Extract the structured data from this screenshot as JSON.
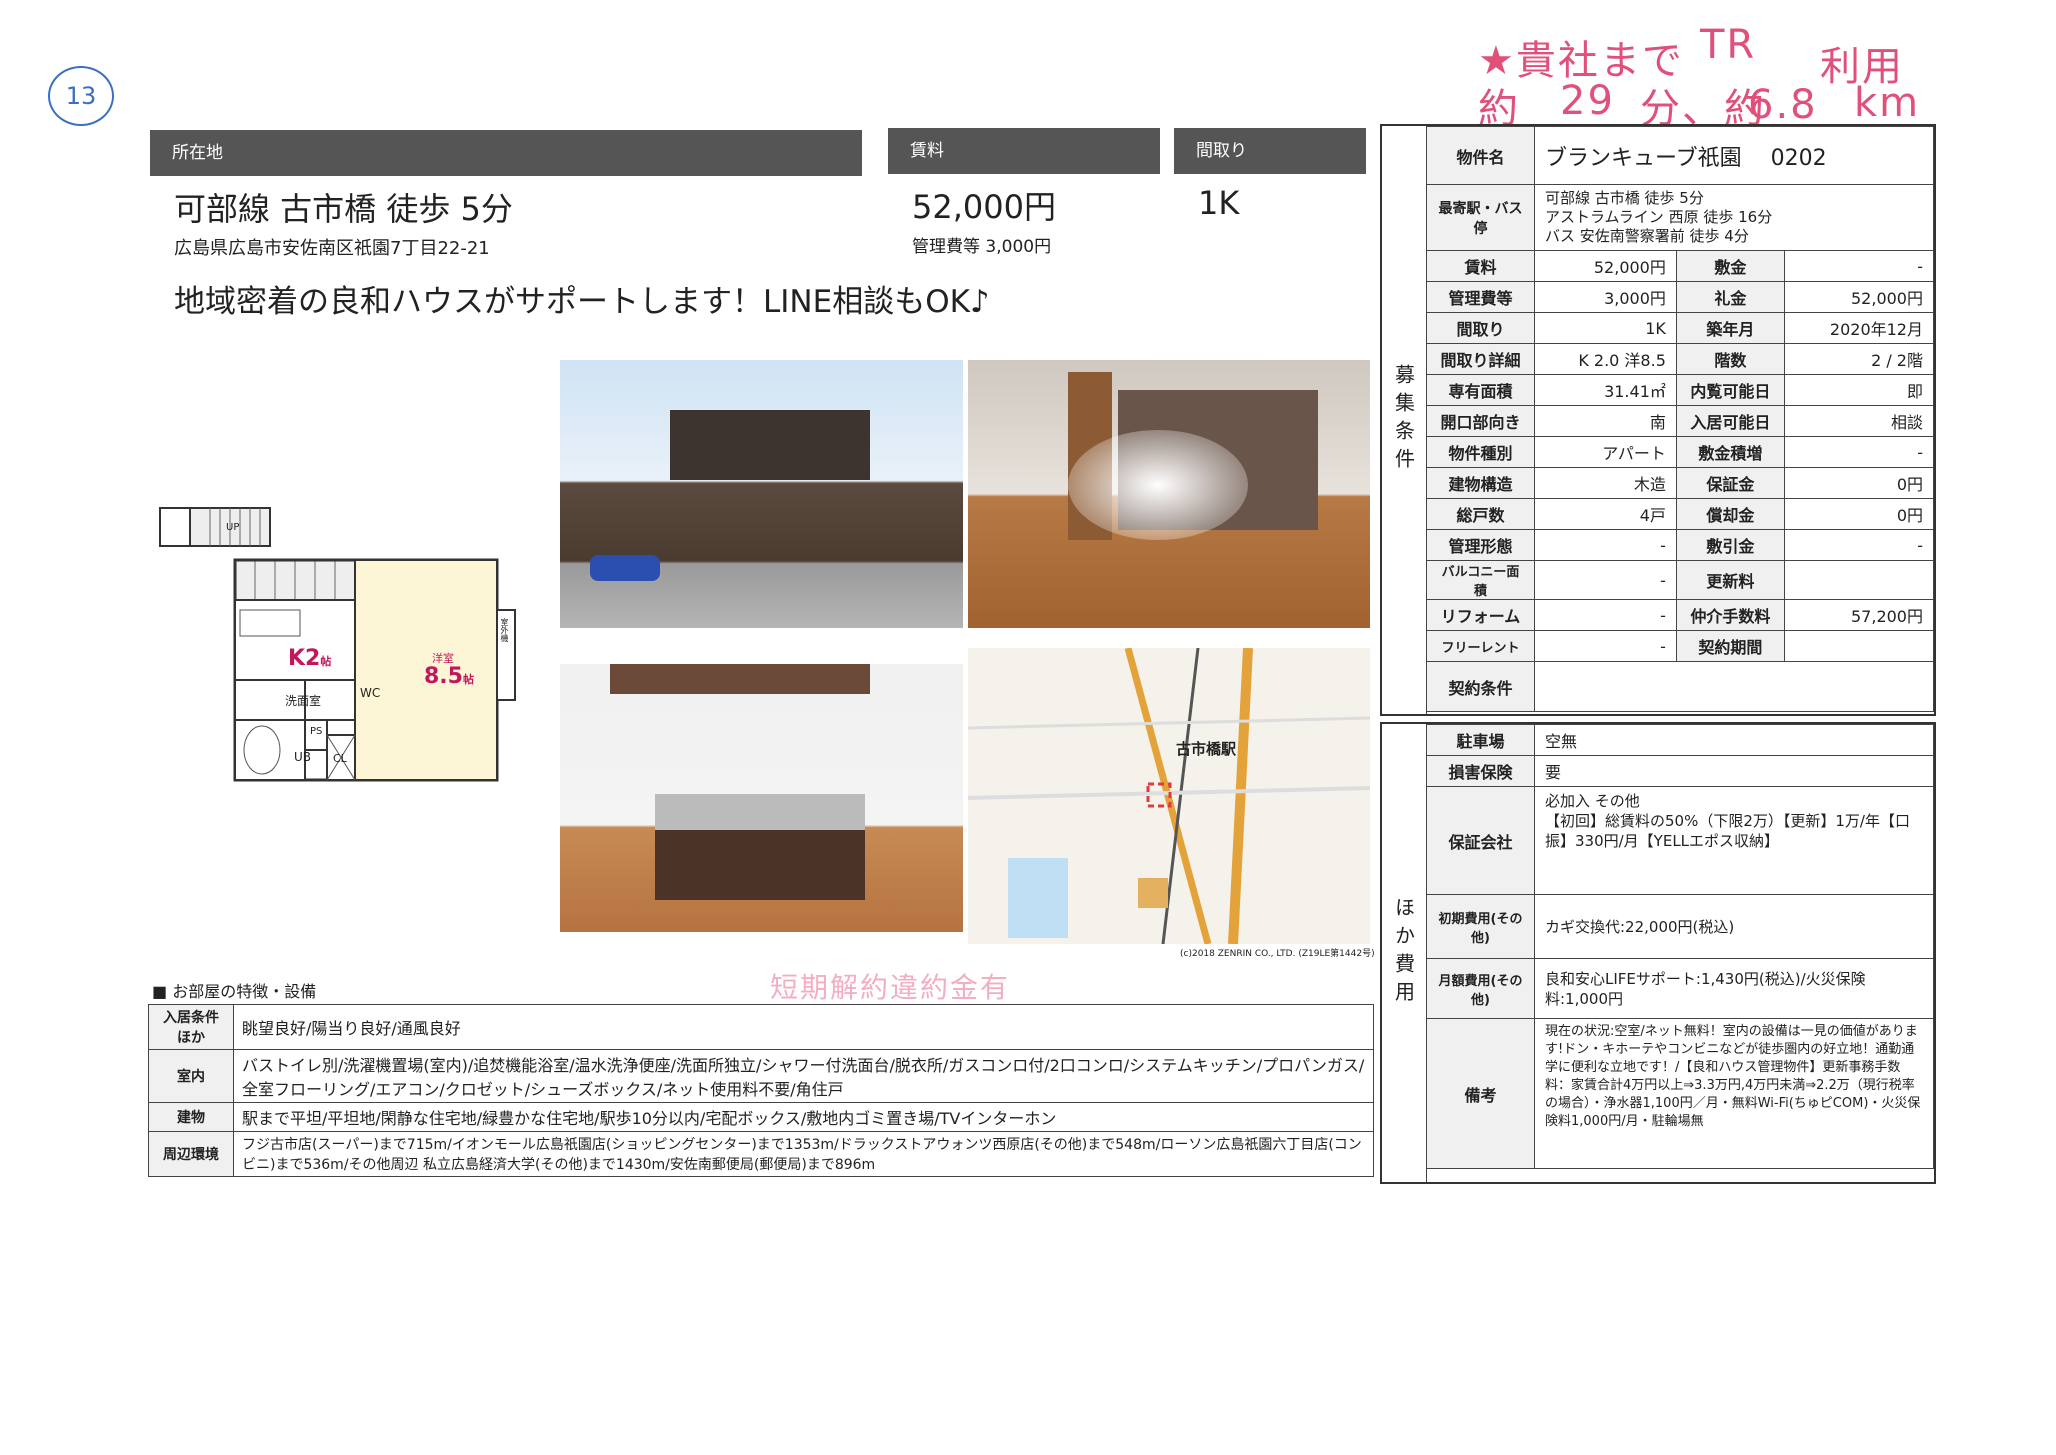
{
  "handwritten": {
    "circled_number": "13",
    "line1": "★貴社まで",
    "transport": "TR",
    "use": "利用",
    "approx1": "約",
    "minutes": "29",
    "fun": "分、約",
    "km_value": "6.8",
    "km_unit": "km"
  },
  "header": {
    "location_label": "所在地",
    "rent_label": "賃料",
    "layout_label": "間取り",
    "access": "可部線 古市橋 徒歩 5分",
    "address": "広島県広島市安佐南区祇園7丁目22-21",
    "rent": "52,000円",
    "management_fee": "管理費等 3,000円",
    "layout": "1K",
    "catchphrase": "地域密着の良和ハウスがサポートします！LINE相談もOK♪"
  },
  "floorplan": {
    "k_label": "K2",
    "k_unit": "帖",
    "room_label": "洋室",
    "room_size": "8.5",
    "room_unit": "帖",
    "washroom": "洗面室",
    "wc": "WC",
    "ub": "UB",
    "ps": "PS",
    "cl": "CL",
    "up": "UP",
    "balcony": "室外機"
  },
  "map": {
    "station": "古市橋駅",
    "copyright": "(c)2018 ZENRIN CO., LTD. (Z19LE第1442号)"
  },
  "spec": {
    "property_name_label": "物件名",
    "property_name": "ブランキューブ祇園　 0202",
    "nearest_label": "最寄駅・バス停",
    "nearest": [
      "可部線 古市橋 徒歩 5分",
      "アストラムライン 西原 徒歩 16分",
      "バス 安佐南警察署前 徒歩 4分"
    ],
    "side_label": "募集条件",
    "rows": [
      {
        "l1": "賃料",
        "v1": "52,000円",
        "l2": "敷金",
        "v2": "-"
      },
      {
        "l1": "管理費等",
        "v1": "3,000円",
        "l2": "礼金",
        "v2": "52,000円"
      },
      {
        "l1": "間取り",
        "v1": "1K",
        "l2": "築年月",
        "v2": "2020年12月"
      },
      {
        "l1": "間取り詳細",
        "v1": "K 2.0 洋8.5",
        "l2": "階数",
        "v2": "2 / 2階"
      },
      {
        "l1": "専有面積",
        "v1": "31.41㎡",
        "l2": "内覧可能日",
        "v2": "即"
      },
      {
        "l1": "開口部向き",
        "v1": "南",
        "l2": "入居可能日",
        "v2": "相談"
      },
      {
        "l1": "物件種別",
        "v1": "アパート",
        "l2": "敷金積増",
        "v2": "-"
      },
      {
        "l1": "建物構造",
        "v1": "木造",
        "l2": "保証金",
        "v2": "0円"
      },
      {
        "l1": "総戸数",
        "v1": "4戸",
        "l2": "償却金",
        "v2": "0円"
      },
      {
        "l1": "管理形態",
        "v1": "-",
        "l2": "敷引金",
        "v2": "-"
      },
      {
        "l1": "バルコニー面積",
        "v1": "-",
        "l2": "更新料",
        "v2": ""
      },
      {
        "l1": "リフォーム",
        "v1": "-",
        "l2": "仲介手数料",
        "v2": "57,200円"
      },
      {
        "l1": "フリーレント",
        "v1": "-",
        "l2": "契約期間",
        "v2": ""
      }
    ],
    "contract_label": "契約条件",
    "contract": ""
  },
  "costs": {
    "side_label": "ほか費用",
    "parking_label": "駐車場",
    "parking": "空無",
    "insurance_label": "損害保険",
    "insurance": "要",
    "guarantor_label": "保証会社",
    "guarantor": "必加入 その他\n【初回】総賃料の50%（下限2万）【更新】1万/年【口振】330円/月【YELLエポス収納】",
    "initial_label": "初期費用(その他)",
    "initial": "カギ交換代:22,000円(税込)",
    "monthly_label": "月額費用(その他)",
    "monthly": "良和安心LIFEサポート:1,430円(税込)/火災保険料:1,000円",
    "notes_label": "備考",
    "notes": "現在の状況:空室/ネット無料！室内の設備は一見の価値があります!ドン・キホーテやコンビニなどが徒歩圏内の好立地！通勤通学に便利な立地です！/【良和ハウス管理物件】更新事務手数料：家賃合計4万円以上⇒3.3万円,4万円未満⇒2.2万（現行税率の場合）・浄水器1,100円／月・無料Wi-Fi(ちゅピCOM)・火災保険料1,000円/月・駐輪場無"
  },
  "features": {
    "heading": "■ お部屋の特徴・設備",
    "stamp": "短期解約違約金有",
    "rows": [
      {
        "label": "入居条件ほか",
        "value": "眺望良好/陽当り良好/通風良好"
      },
      {
        "label": "室内",
        "value": "バストイレ別/洗濯機置場(室内)/追焚機能浴室/温水洗浄便座/洗面所独立/シャワー付洗面台/脱衣所/ガスコンロ付/2口コンロ/システムキッチン/プロパンガス/全室フローリング/エアコン/クロゼット/シューズボックス/ネット使用料不要/角住戸"
      },
      {
        "label": "建物",
        "value": "駅まで平坦/平坦地/閑静な住宅地/緑豊かな住宅地/駅歩10分以内/宅配ボックス/敷地内ゴミ置き場/TVインターホン"
      },
      {
        "label": "周辺環境",
        "value": "フジ古市店(スーパー)まで715m/イオンモール広島祇園店(ショッピングセンター)まで1353m/ドラックストアウォンツ西原店(その他)まで548m/ローソン広島祇園六丁目店(コンビニ)まで536m/その他周辺 私立広島経済大学(その他)まで1430m/安佐南郵便局(郵便局)まで896m"
      }
    ]
  }
}
